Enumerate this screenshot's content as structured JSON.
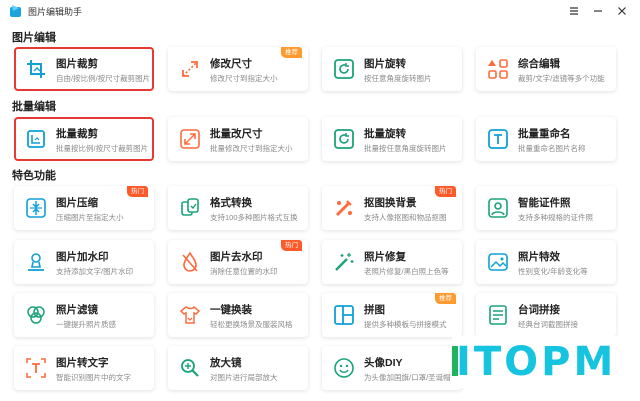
{
  "app": {
    "title": "图片编辑助手"
  },
  "colors": {
    "accent": "#0fa0d6",
    "hot_badge": "#ff5a2a",
    "recommend_badge": "#ff9a2e",
    "selection_box": "#e53935",
    "watermark": "#16c4e0"
  },
  "sections": [
    {
      "title": "图片编辑"
    },
    {
      "title": "批量编辑"
    },
    {
      "title": "特色功能"
    }
  ],
  "cards": [
    {
      "title": "图片裁剪",
      "desc": "自由/按比例/按尺寸裁剪图片",
      "icon": "crop-icon"
    },
    {
      "title": "修改尺寸",
      "desc": "修改尺寸到指定大小",
      "icon": "resize-arrows-icon",
      "badge": "推荐"
    },
    {
      "title": "图片旋转",
      "desc": "按任意角度旋转图片",
      "icon": "rotate-icon"
    },
    {
      "title": "综合编辑",
      "desc": "裁剪/文字/滤镜等多个功能",
      "icon": "shapes-icon"
    },
    {
      "title": "批量裁剪",
      "desc": "批量按比例/按尺寸裁剪图片",
      "icon": "batch-crop-icon"
    },
    {
      "title": "批量改尺寸",
      "desc": "批量修改尺寸到指定大小",
      "icon": "batch-resize-icon"
    },
    {
      "title": "批量旋转",
      "desc": "批量按任意角度旋转图片",
      "icon": "batch-rotate-icon"
    },
    {
      "title": "批量重命名",
      "desc": "批量重命名图片名称",
      "icon": "rename-icon"
    },
    {
      "title": "图片压缩",
      "desc": "压缩图片至指定大小",
      "icon": "compress-icon",
      "badge": "热门"
    },
    {
      "title": "格式转换",
      "desc": "支持100多种图片格式互换",
      "icon": "format-convert-icon"
    },
    {
      "title": "抠图换背景",
      "desc": "支持人像抠图和物品抠图",
      "icon": "cutout-icon",
      "badge": "热门"
    },
    {
      "title": "智能证件照",
      "desc": "支持多种规格的证件照",
      "icon": "id-photo-icon"
    },
    {
      "title": "图片加水印",
      "desc": "支持添加文字/图片水印",
      "icon": "add-watermark-icon"
    },
    {
      "title": "图片去水印",
      "desc": "消除任意位置的水印",
      "icon": "remove-watermark-icon",
      "badge": "热门"
    },
    {
      "title": "照片修复",
      "desc": "老照片修复/黑白照上色等",
      "icon": "magic-wand-icon"
    },
    {
      "title": "照片特效",
      "desc": "性别变化/年龄变化等",
      "icon": "effects-icon"
    },
    {
      "title": "照片滤镜",
      "desc": "一键提升照片质感",
      "icon": "filter-icon"
    },
    {
      "title": "一键换装",
      "desc": "轻松更换场景及服装风格",
      "icon": "outfit-icon"
    },
    {
      "title": "拼图",
      "desc": "提供多种模板与拼接模式",
      "icon": "collage-icon",
      "badge": "推荐"
    },
    {
      "title": "台词拼接",
      "desc": "经典台词截图拼接",
      "icon": "subtitle-stitch-icon"
    },
    {
      "title": "图片转文字",
      "desc": "智能识别图片中的文字",
      "icon": "ocr-icon"
    },
    {
      "title": "放大镜",
      "desc": "对图片进行局部放大",
      "icon": "magnifier-icon"
    },
    {
      "title": "头像DIY",
      "desc": "为头像加国旗/口罩/圣诞帽",
      "icon": "avatar-icon"
    }
  ],
  "watermark": {
    "text": "ITOPM"
  }
}
